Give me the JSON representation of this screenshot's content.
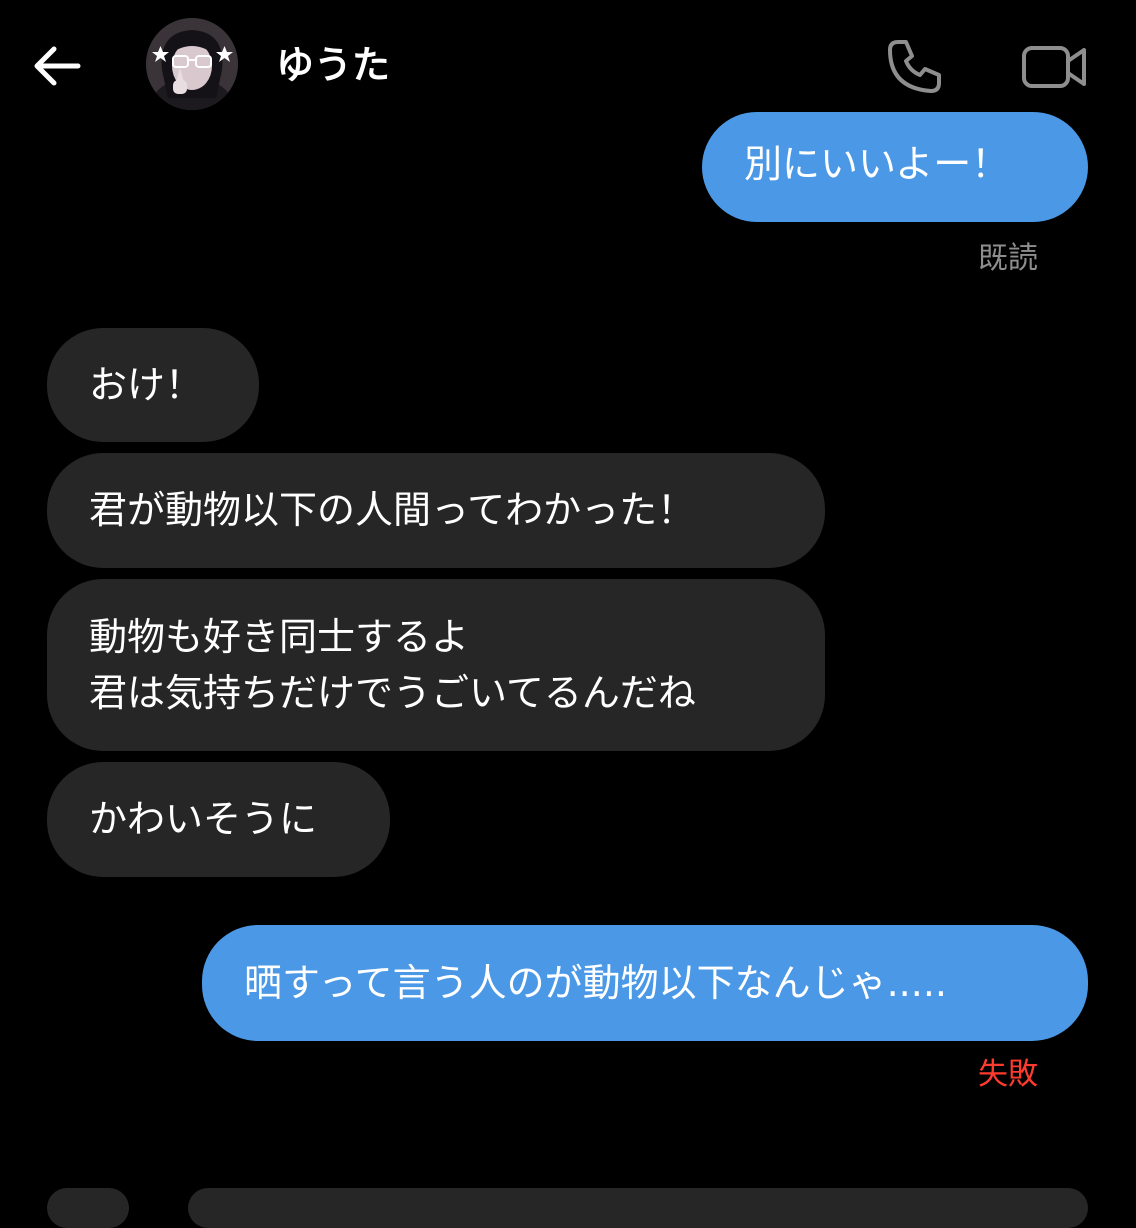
{
  "header": {
    "contact_name": "ゆうた",
    "back_icon": "arrow-left-icon",
    "call_icon": "phone-icon",
    "video_icon": "video-camera-icon"
  },
  "messages": [
    {
      "direction": "outgoing",
      "text": "別にいいよー！",
      "status": "既読"
    },
    {
      "direction": "incoming",
      "text": "おけ！"
    },
    {
      "direction": "incoming",
      "text": "君が動物以下の人間ってわかった！"
    },
    {
      "direction": "incoming",
      "lines": [
        "動物も好き同士するよ",
        "君は気持ちだけでうごいてるんだね"
      ]
    },
    {
      "direction": "incoming",
      "text": "かわいそうに"
    },
    {
      "direction": "outgoing",
      "text": "晒すって言う人のが動物以下なんじゃ.....",
      "status": "失敗"
    }
  ],
  "colors": {
    "background": "#000000",
    "outgoing_bubble": "#4a98e6",
    "incoming_bubble": "#262626",
    "read_status": "#8e8e8e",
    "failed_status": "#ff3b30",
    "header_icon": "#8e8e8e"
  }
}
